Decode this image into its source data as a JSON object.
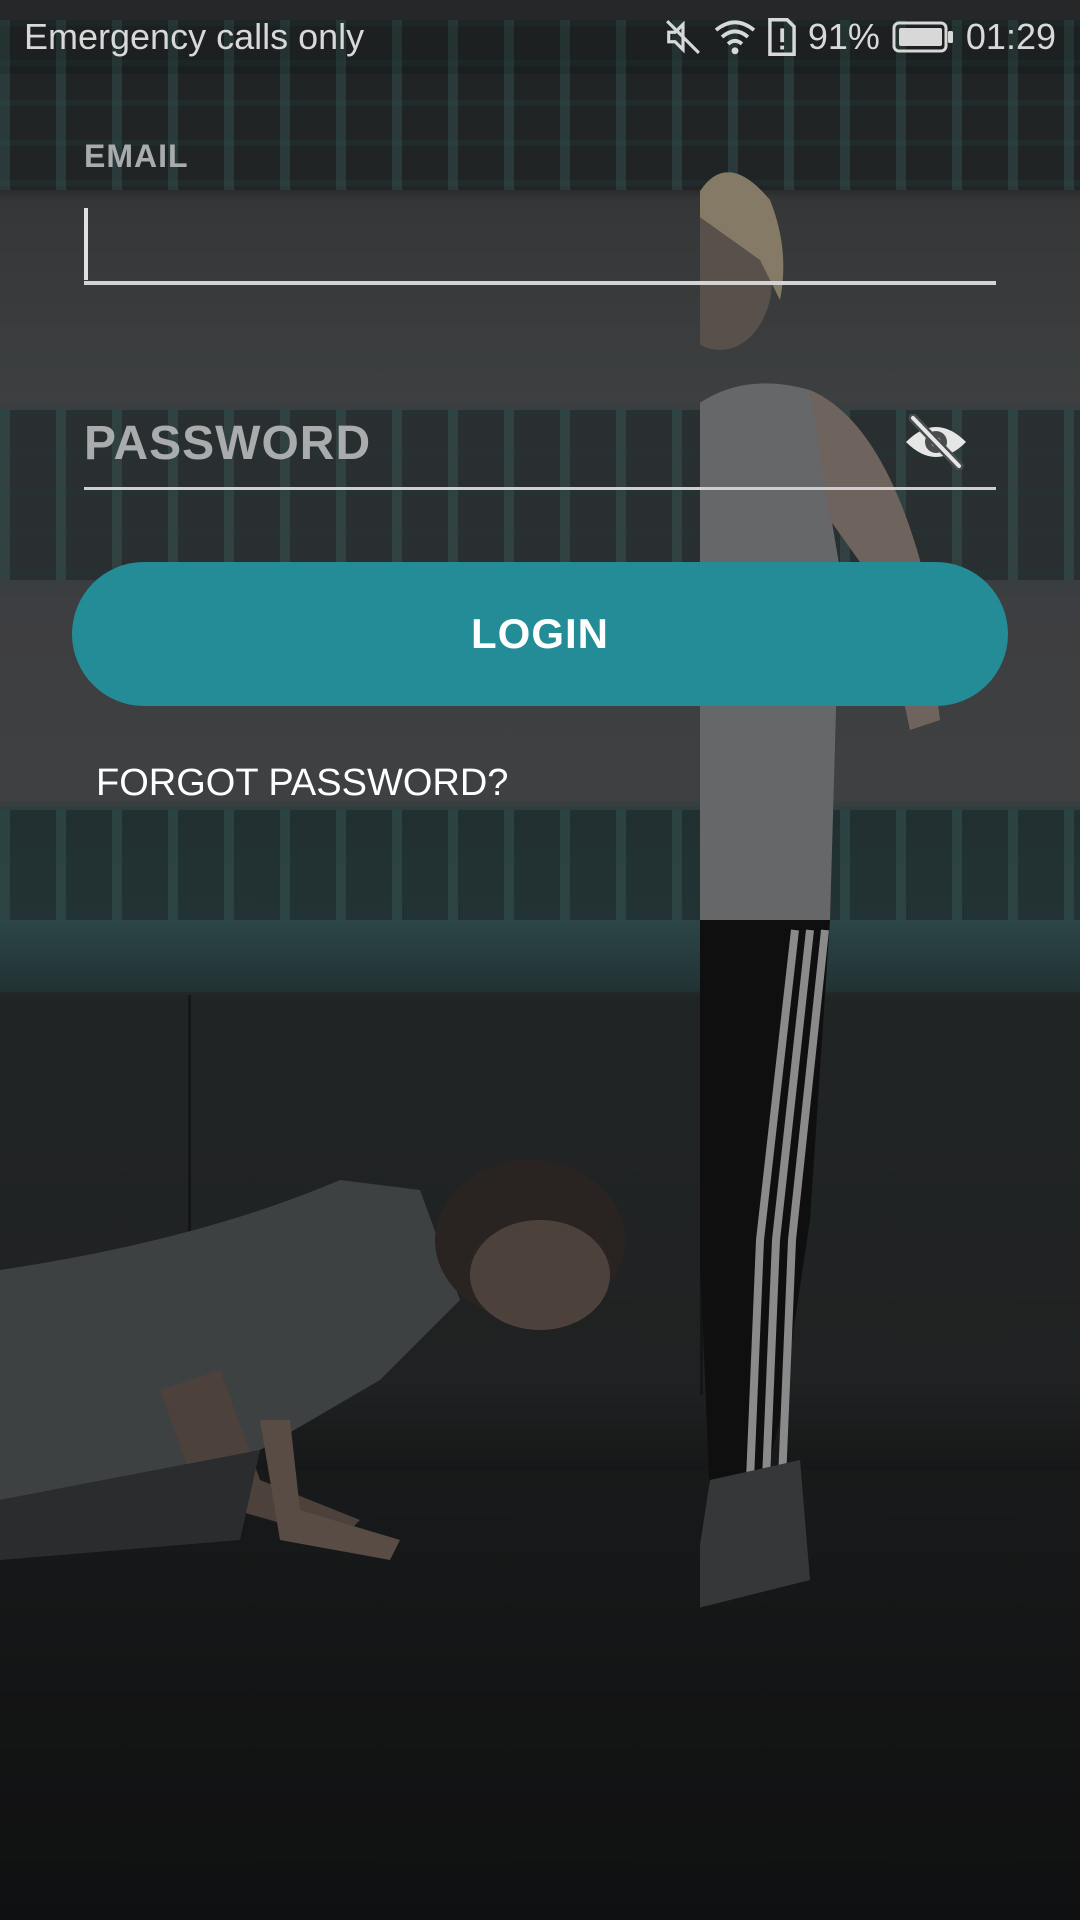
{
  "status_bar": {
    "carrier": "Emergency calls only",
    "battery_percent": "91%",
    "time": "01:29",
    "icons": [
      "mute-icon",
      "wifi-icon",
      "sim-alert-icon",
      "battery-icon"
    ]
  },
  "login_form": {
    "email_label": "EMAIL",
    "email_value": "",
    "password_placeholder": "PASSWORD",
    "password_value": "",
    "visibility_icon": "eye-off-icon",
    "login_label": "LOGIN",
    "forgot_label": "FORGOT PASSWORD?"
  },
  "colors": {
    "accent": "#238c96",
    "label": "#a9abac",
    "underline": "#d4d4d4"
  }
}
